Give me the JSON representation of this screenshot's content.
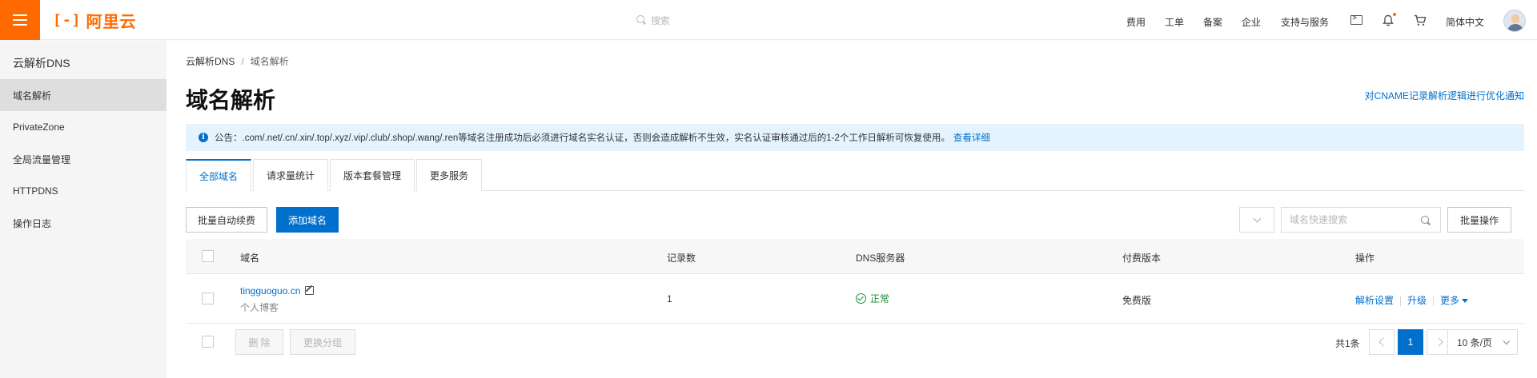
{
  "topbar": {
    "logo_text": "阿里云",
    "search_placeholder": "搜索",
    "nav": [
      "费用",
      "工单",
      "备案",
      "企业",
      "支持与服务"
    ],
    "language": "简体中文"
  },
  "sidebar": {
    "title": "云解析DNS",
    "items": [
      {
        "label": "域名解析",
        "active": true
      },
      {
        "label": "PrivateZone",
        "active": false
      },
      {
        "label": "全局流量管理",
        "active": false
      },
      {
        "label": "HTTPDNS",
        "active": false
      },
      {
        "label": "操作日志",
        "active": false
      }
    ]
  },
  "breadcrumb": {
    "root": "云解析DNS",
    "current": "域名解析"
  },
  "page": {
    "title": "域名解析",
    "notice_link": "对CNAME记录解析逻辑进行优化通知"
  },
  "notice": {
    "text": "公告：.com/.net/.cn/.xin/.top/.xyz/.vip/.club/.shop/.wang/.ren等域名注册成功后必须进行域名实名认证，否则会造成解析不生效，实名认证审核通过后的1-2个工作日解析可恢复使用。",
    "link": "查看详细"
  },
  "tabs": [
    "全部域名",
    "请求量统计",
    "版本套餐管理",
    "更多服务"
  ],
  "toolbar": {
    "batch_renew": "批量自动续费",
    "add_domain": "添加域名",
    "search_placeholder": "域名快速搜索",
    "batch_ops": "批量操作"
  },
  "table": {
    "headers": {
      "domain": "域名",
      "records": "记录数",
      "dns": "DNS服务器",
      "edition": "付费版本",
      "ops": "操作"
    },
    "rows": [
      {
        "domain": "tingguoguo.cn",
        "remark": "个人博客",
        "records": "1",
        "dns_status": "正常",
        "edition": "免费版",
        "ops": {
          "settings": "解析设置",
          "upgrade": "升级",
          "more": "更多"
        }
      }
    ]
  },
  "footer": {
    "delete": "删 除",
    "change_group": "更换分组",
    "total": "共1条",
    "current_page": "1",
    "page_size": "10 条/页"
  },
  "colors": {
    "brand": "#ff6a00",
    "link": "#0070cc",
    "success": "#1e8e3e",
    "notice_bg": "#e5f3ff"
  },
  "icons": [
    "menu-icon",
    "search-icon",
    "terminal-icon",
    "bell-icon",
    "cart-icon",
    "info-icon",
    "edit-icon",
    "check-circle-icon",
    "chevron-left-icon",
    "chevron-right-icon",
    "chevron-down-icon"
  ]
}
